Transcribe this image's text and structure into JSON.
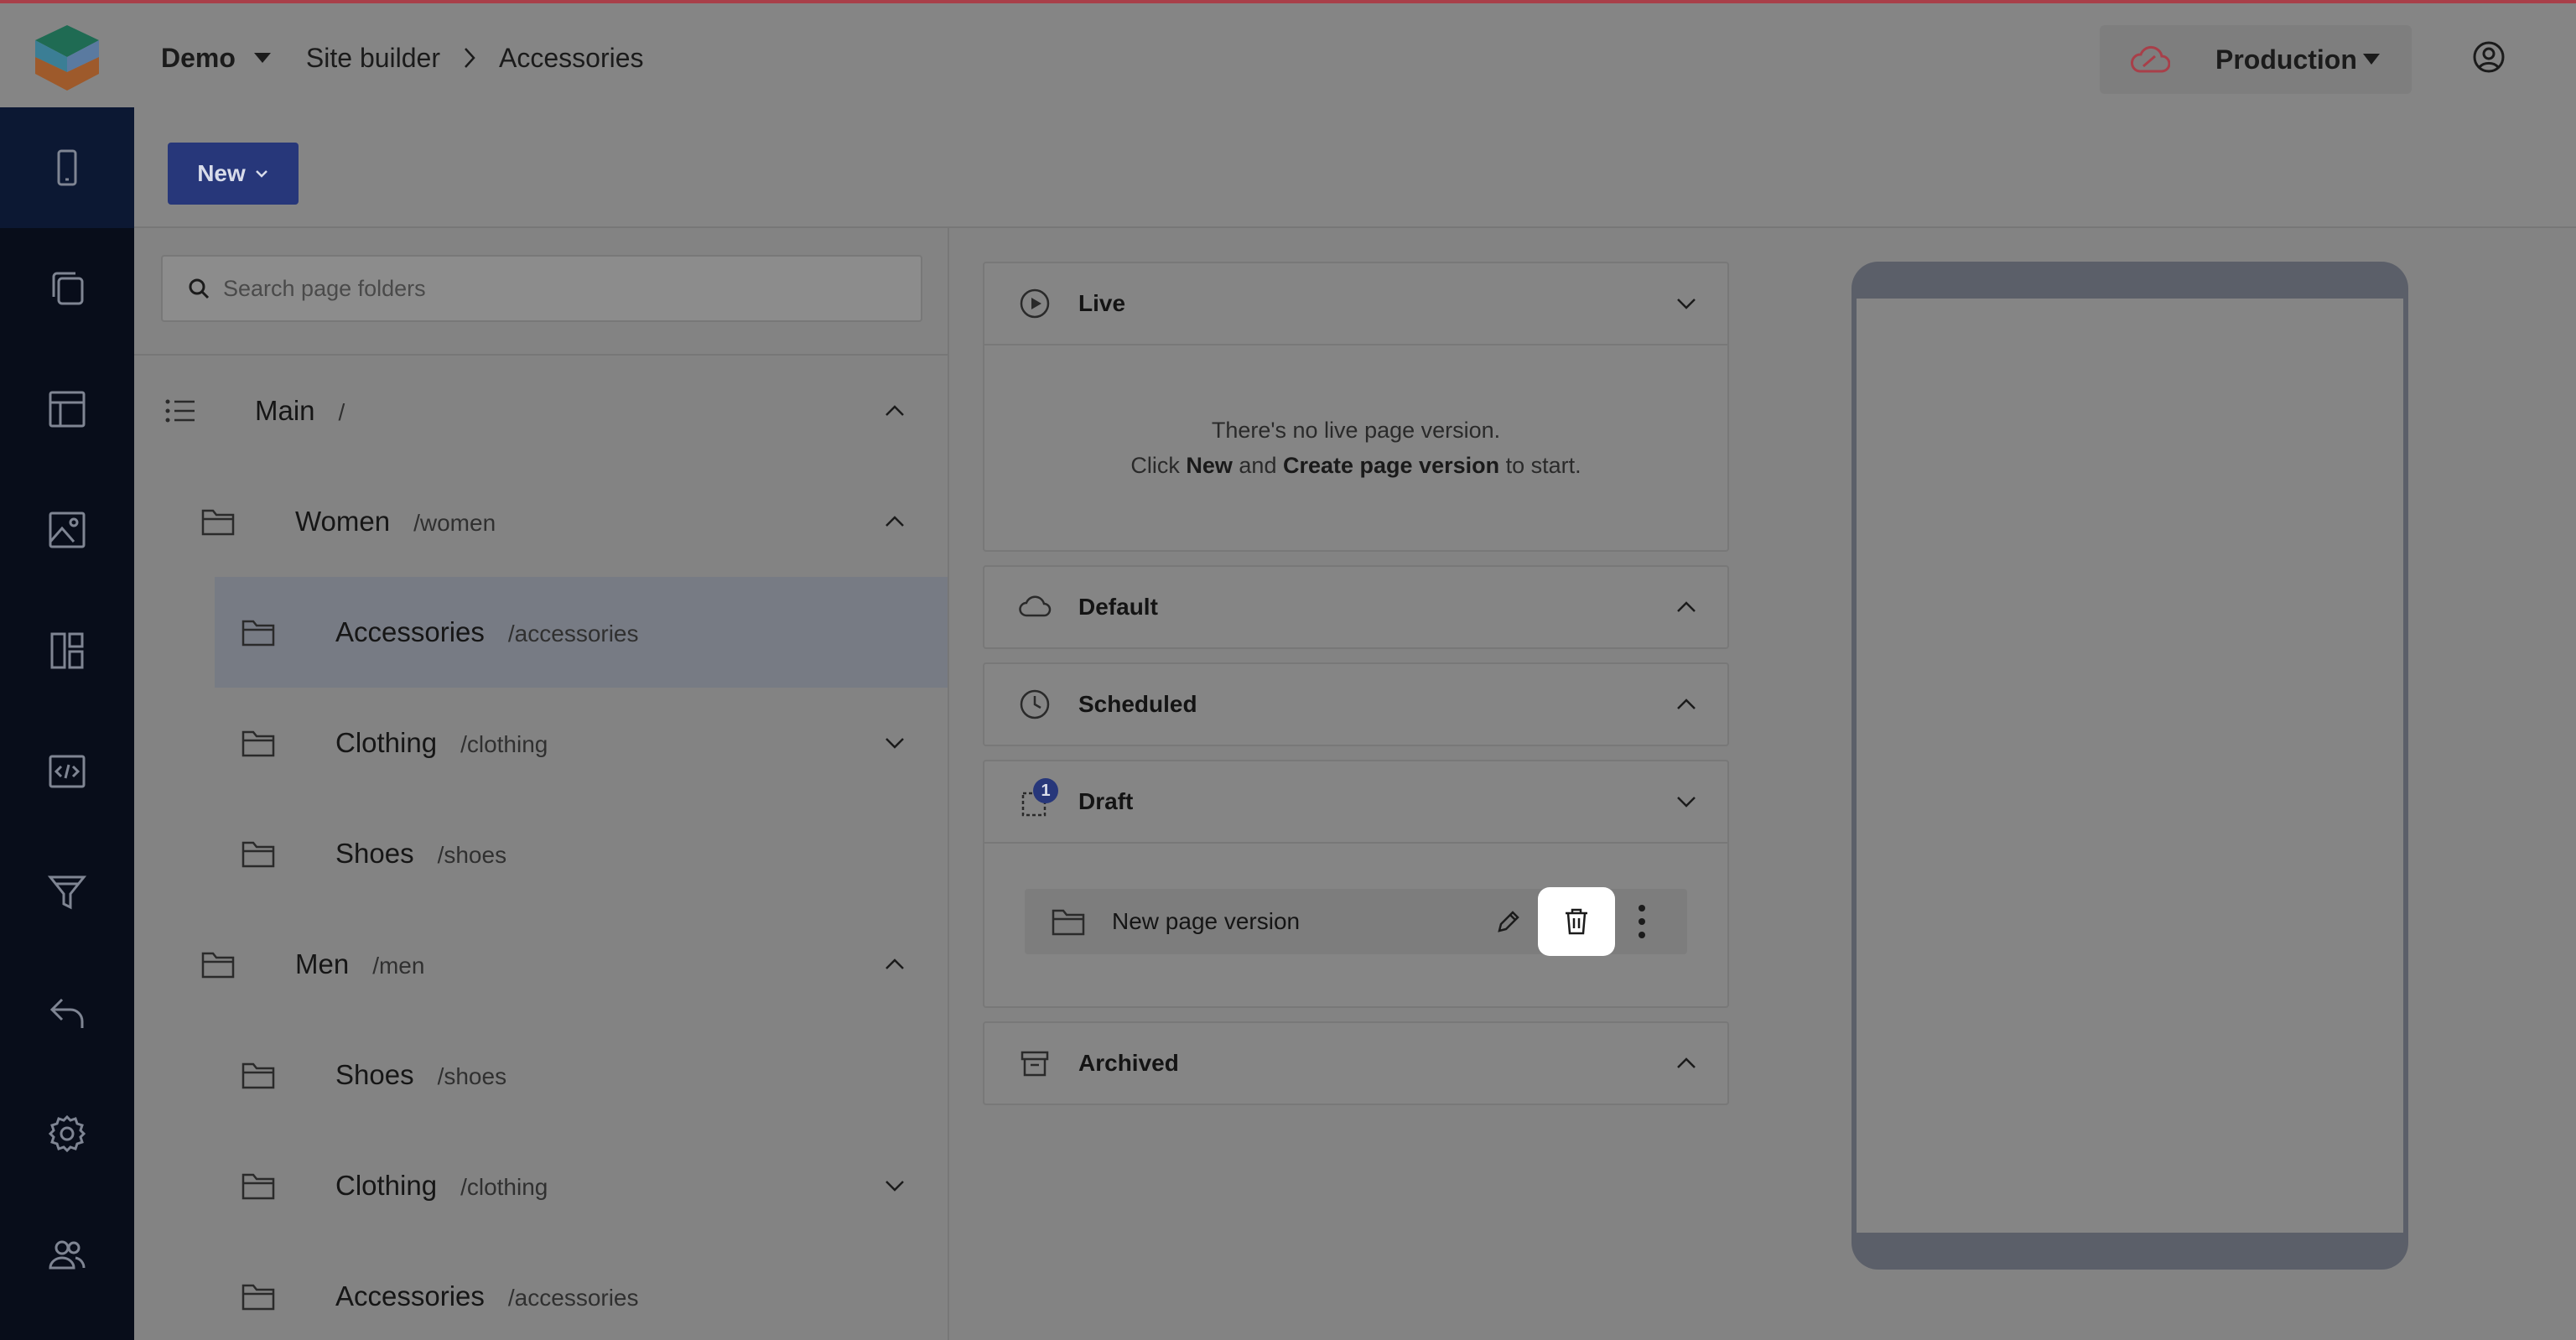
{
  "header": {
    "project": "Demo",
    "breadcrumb": [
      "Site builder",
      "Accessories"
    ],
    "environment": "Production",
    "colors": {
      "accent_bar": "#a83f49",
      "cloud_icon": "#a83f49"
    }
  },
  "sidenav": {
    "items": [
      {
        "icon": "mobile-device-icon",
        "active": true
      },
      {
        "icon": "copy-pages-icon"
      },
      {
        "icon": "layout-icon"
      },
      {
        "icon": "image-icon"
      },
      {
        "icon": "components-icon"
      },
      {
        "icon": "code-icon"
      },
      {
        "icon": "filter-icon"
      },
      {
        "icon": "undo-icon"
      },
      {
        "icon": "settings-gear-icon"
      },
      {
        "icon": "users-icon"
      }
    ]
  },
  "toolbar": {
    "new_label": "New"
  },
  "folders": {
    "search_placeholder": "Search page folders",
    "items": [
      {
        "name": "Main",
        "path": "/",
        "icon": "list-icon",
        "expanded": true
      },
      {
        "name": "Women",
        "path": "/women",
        "icon": "folder-icon",
        "expanded": true
      },
      {
        "name": "Accessories",
        "path": "/accessories",
        "icon": "folder-icon",
        "selected": true
      },
      {
        "name": "Clothing",
        "path": "/clothing",
        "icon": "folder-icon",
        "expanded": false
      },
      {
        "name": "Shoes",
        "path": "/shoes",
        "icon": "folder-icon"
      },
      {
        "name": "Men",
        "path": "/men",
        "icon": "folder-icon",
        "expanded": true
      },
      {
        "name": "Shoes",
        "path": "/shoes",
        "icon": "folder-icon"
      },
      {
        "name": "Clothing",
        "path": "/clothing",
        "icon": "folder-icon",
        "expanded": false
      },
      {
        "name": "Accessories",
        "path": "/accessories",
        "icon": "folder-icon"
      }
    ]
  },
  "versions": {
    "live": {
      "title": "Live",
      "empty_line1": "There's no live page version.",
      "empty_click": "Click",
      "empty_new": "New",
      "empty_and": "and",
      "empty_create": "Create page version",
      "empty_end": "to start."
    },
    "default": {
      "title": "Default"
    },
    "scheduled": {
      "title": "Scheduled"
    },
    "draft": {
      "title": "Draft",
      "count": "1",
      "item_name": "New page version"
    },
    "archived": {
      "title": "Archived"
    }
  }
}
